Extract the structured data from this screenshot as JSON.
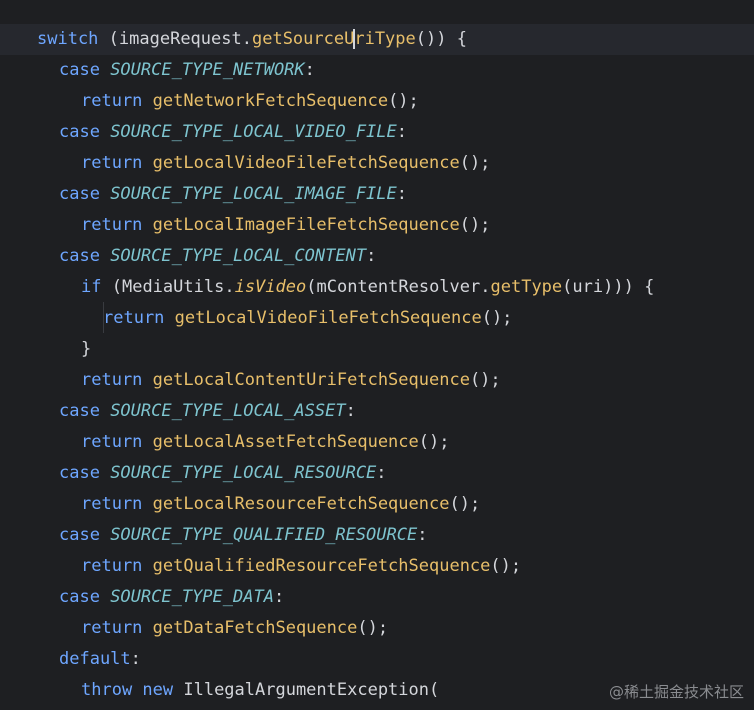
{
  "lines": [
    {
      "indent": 1,
      "current": true,
      "tokens": [
        {
          "c": "tk-kw",
          "t": "switch"
        },
        {
          "c": "tk-punc",
          "t": " ("
        },
        {
          "c": "tk-ident",
          "t": "imageRequest"
        },
        {
          "c": "tk-punc",
          "t": "."
        },
        {
          "c": "tk-fn",
          "t": "getSourceU"
        },
        {
          "c": "caret",
          "t": ""
        },
        {
          "c": "tk-fn",
          "t": "riType"
        },
        {
          "c": "tk-punc",
          "t": "()) {"
        }
      ]
    },
    {
      "indent": 2,
      "tokens": [
        {
          "c": "tk-case",
          "t": "case "
        },
        {
          "c": "tk-const",
          "t": "SOURCE_TYPE_NETWORK"
        },
        {
          "c": "tk-punc",
          "t": ":"
        }
      ]
    },
    {
      "indent": 3,
      "tokens": [
        {
          "c": "tk-kw",
          "t": "return "
        },
        {
          "c": "tk-fn",
          "t": "getNetworkFetchSequence"
        },
        {
          "c": "tk-punc",
          "t": "();"
        }
      ]
    },
    {
      "indent": 2,
      "tokens": [
        {
          "c": "tk-case",
          "t": "case "
        },
        {
          "c": "tk-const",
          "t": "SOURCE_TYPE_LOCAL_VIDEO_FILE"
        },
        {
          "c": "tk-punc",
          "t": ":"
        }
      ]
    },
    {
      "indent": 3,
      "tokens": [
        {
          "c": "tk-kw",
          "t": "return "
        },
        {
          "c": "tk-fn",
          "t": "getLocalVideoFileFetchSequence"
        },
        {
          "c": "tk-punc",
          "t": "();"
        }
      ]
    },
    {
      "indent": 2,
      "tokens": [
        {
          "c": "tk-case",
          "t": "case "
        },
        {
          "c": "tk-const",
          "t": "SOURCE_TYPE_LOCAL_IMAGE_FILE"
        },
        {
          "c": "tk-punc",
          "t": ":"
        }
      ]
    },
    {
      "indent": 3,
      "tokens": [
        {
          "c": "tk-kw",
          "t": "return "
        },
        {
          "c": "tk-fn",
          "t": "getLocalImageFileFetchSequence"
        },
        {
          "c": "tk-punc",
          "t": "();"
        }
      ]
    },
    {
      "indent": 2,
      "tokens": [
        {
          "c": "tk-case",
          "t": "case "
        },
        {
          "c": "tk-const",
          "t": "SOURCE_TYPE_LOCAL_CONTENT"
        },
        {
          "c": "tk-punc",
          "t": ":"
        }
      ]
    },
    {
      "indent": 3,
      "tokens": [
        {
          "c": "tk-kw",
          "t": "if "
        },
        {
          "c": "tk-punc",
          "t": "("
        },
        {
          "c": "tk-ident",
          "t": "MediaUtils"
        },
        {
          "c": "tk-punc",
          "t": "."
        },
        {
          "c": "tk-fn-ital",
          "t": "isVideo"
        },
        {
          "c": "tk-punc",
          "t": "("
        },
        {
          "c": "tk-ident",
          "t": "mContentResolver"
        },
        {
          "c": "tk-punc",
          "t": "."
        },
        {
          "c": "tk-fn",
          "t": "getType"
        },
        {
          "c": "tk-punc",
          "t": "("
        },
        {
          "c": "tk-ident",
          "t": "uri"
        },
        {
          "c": "tk-punc",
          "t": "))) {"
        }
      ]
    },
    {
      "indent": 4,
      "tokens": [
        {
          "c": "tk-kw",
          "t": "return "
        },
        {
          "c": "tk-fn",
          "t": "getLocalVideoFileFetchSequence"
        },
        {
          "c": "tk-punc",
          "t": "();"
        }
      ]
    },
    {
      "indent": 3,
      "tokens": [
        {
          "c": "tk-punc",
          "t": "}"
        }
      ]
    },
    {
      "indent": 3,
      "tokens": [
        {
          "c": "tk-kw",
          "t": "return "
        },
        {
          "c": "tk-fn",
          "t": "getLocalContentUriFetchSequence"
        },
        {
          "c": "tk-punc",
          "t": "();"
        }
      ]
    },
    {
      "indent": 2,
      "tokens": [
        {
          "c": "tk-case",
          "t": "case "
        },
        {
          "c": "tk-const",
          "t": "SOURCE_TYPE_LOCAL_ASSET"
        },
        {
          "c": "tk-punc",
          "t": ":"
        }
      ]
    },
    {
      "indent": 3,
      "tokens": [
        {
          "c": "tk-kw",
          "t": "return "
        },
        {
          "c": "tk-fn",
          "t": "getLocalAssetFetchSequence"
        },
        {
          "c": "tk-punc",
          "t": "();"
        }
      ]
    },
    {
      "indent": 2,
      "tokens": [
        {
          "c": "tk-case",
          "t": "case "
        },
        {
          "c": "tk-const",
          "t": "SOURCE_TYPE_LOCAL_RESOURCE"
        },
        {
          "c": "tk-punc",
          "t": ":"
        }
      ]
    },
    {
      "indent": 3,
      "tokens": [
        {
          "c": "tk-kw",
          "t": "return "
        },
        {
          "c": "tk-fn",
          "t": "getLocalResourceFetchSequence"
        },
        {
          "c": "tk-punc",
          "t": "();"
        }
      ]
    },
    {
      "indent": 2,
      "tokens": [
        {
          "c": "tk-case",
          "t": "case "
        },
        {
          "c": "tk-const",
          "t": "SOURCE_TYPE_QUALIFIED_RESOURCE"
        },
        {
          "c": "tk-punc",
          "t": ":"
        }
      ]
    },
    {
      "indent": 3,
      "tokens": [
        {
          "c": "tk-kw",
          "t": "return "
        },
        {
          "c": "tk-fn",
          "t": "getQualifiedResourceFetchSequence"
        },
        {
          "c": "tk-punc",
          "t": "();"
        }
      ]
    },
    {
      "indent": 2,
      "tokens": [
        {
          "c": "tk-case",
          "t": "case "
        },
        {
          "c": "tk-const",
          "t": "SOURCE_TYPE_DATA"
        },
        {
          "c": "tk-punc",
          "t": ":"
        }
      ]
    },
    {
      "indent": 3,
      "tokens": [
        {
          "c": "tk-kw",
          "t": "return "
        },
        {
          "c": "tk-fn",
          "t": "getDataFetchSequence"
        },
        {
          "c": "tk-punc",
          "t": "();"
        }
      ]
    },
    {
      "indent": 2,
      "tokens": [
        {
          "c": "tk-case",
          "t": "default"
        },
        {
          "c": "tk-punc",
          "t": ":"
        }
      ]
    },
    {
      "indent": 3,
      "tokens": [
        {
          "c": "tk-kw",
          "t": "throw new "
        },
        {
          "c": "tk-type",
          "t": "IllegalArgumentException"
        },
        {
          "c": "tk-punc",
          "t": "("
        }
      ]
    }
  ],
  "watermark": "@稀土掘金技术社区",
  "colors": {
    "background": "#1e1f22",
    "current_line": "#26282e",
    "keyword": "#6ea6ff",
    "constant": "#7ec4cf",
    "method": "#e8bf6a",
    "text": "#d4d6db"
  }
}
